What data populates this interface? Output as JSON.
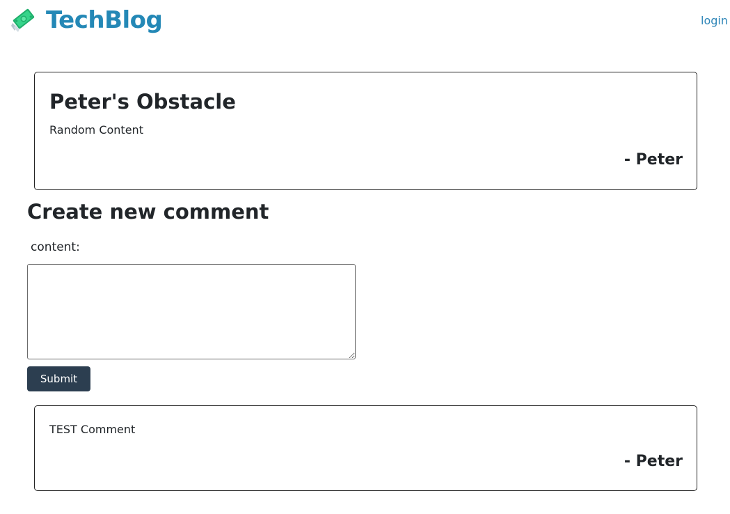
{
  "header": {
    "logo_icon": "money-with-wings-icon",
    "brand": "TechBlog",
    "login_label": "login"
  },
  "post": {
    "title": "Peter's Obstacle",
    "content": "Random Content",
    "author": "- Peter"
  },
  "comment_form": {
    "heading": "Create new comment",
    "content_label": "content:",
    "content_value": "",
    "submit_label": "Submit"
  },
  "comments": [
    {
      "content": "TEST Comment",
      "author": "- Peter"
    }
  ],
  "colors": {
    "brand": "#2488b6",
    "link": "#2f86b8",
    "button_bg": "#2c3e50",
    "button_text": "#ffffff",
    "text": "#212529",
    "border": "#222222"
  }
}
